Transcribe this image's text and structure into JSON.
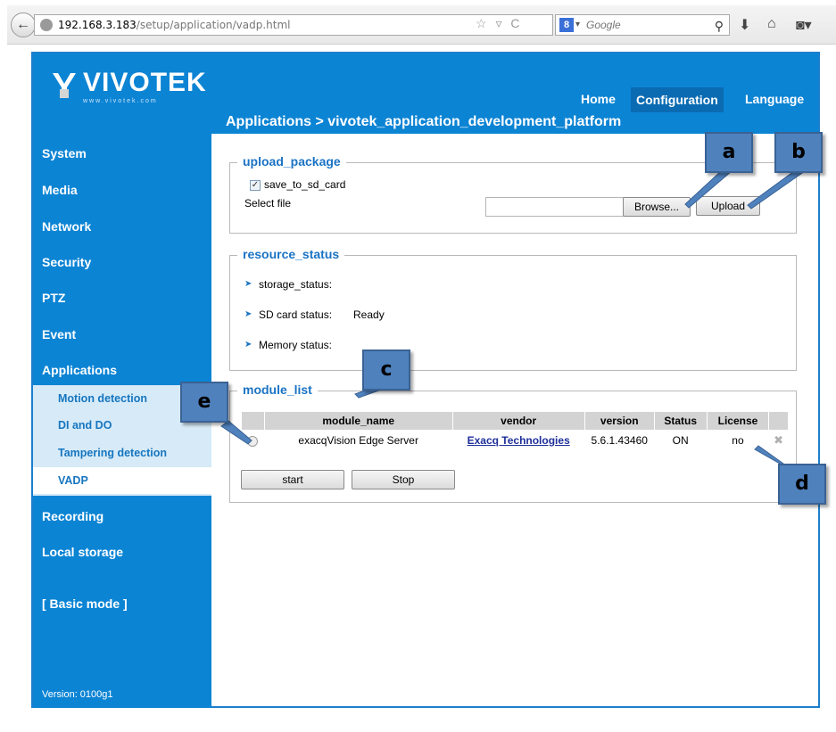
{
  "browser": {
    "url_host": "192.168.3.183",
    "url_path": "/setup/application/vadp.html",
    "search_engine_label": "Google",
    "search_badge": "8"
  },
  "header": {
    "logo_text": "VIVOTEK",
    "logo_sub": "www.vivotek.com",
    "nav": {
      "home": "Home",
      "configuration": "Configuration",
      "language": "Language"
    },
    "breadcrumb": "Applications  > vivotek_application_development_platform"
  },
  "sidebar": {
    "items": [
      "System",
      "Media",
      "Network",
      "Security",
      "PTZ",
      "Event",
      "Applications"
    ],
    "sub_items": [
      "Motion detection",
      "DI and DO",
      "Tampering detection",
      "VADP"
    ],
    "bottom_items": [
      "Recording",
      "Local storage"
    ],
    "basic_mode": "[ Basic mode ]",
    "version": "Version: 0100g1"
  },
  "upload": {
    "title": "upload_package",
    "save_checkbox_label": "save_to_sd_card",
    "save_checked": true,
    "select_file_label": "Select file",
    "browse_label": "Browse...",
    "upload_label": "Upload"
  },
  "resource": {
    "title": "resource_status",
    "storage_label": "storage_status:",
    "sd_label": "SD card status:",
    "sd_value": "Ready",
    "memory_label": "Memory status:"
  },
  "modules": {
    "title": "module_list",
    "columns": [
      "module_name",
      "vendor",
      "version",
      "Status",
      "License"
    ],
    "rows": [
      {
        "module_name": "exacqVision Edge Server",
        "vendor": "Exacq Technologies",
        "version": "5.6.1.43460",
        "status": "ON",
        "license": "no"
      }
    ],
    "start_label": "start",
    "stop_label": "Stop"
  },
  "callouts": {
    "a": "a",
    "b": "b",
    "c": "c",
    "d": "d",
    "e": "e"
  }
}
